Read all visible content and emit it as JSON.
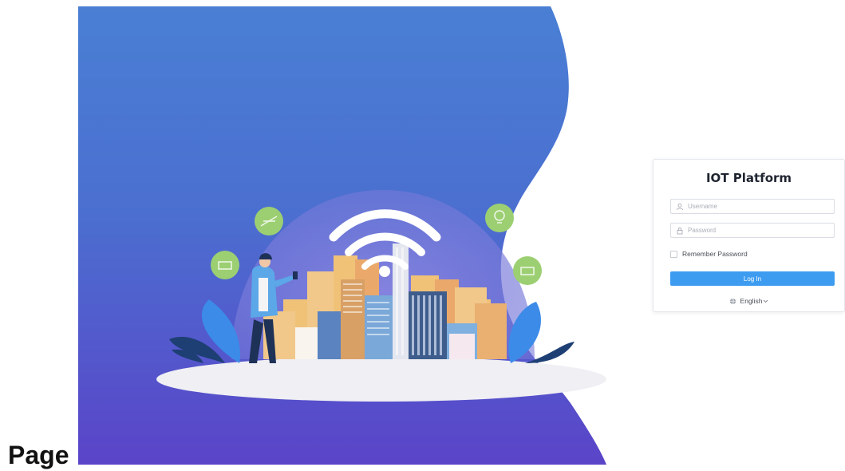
{
  "page_label": "Page",
  "login": {
    "title": "IOT Platform",
    "username_placeholder": "Username",
    "password_placeholder": "Password",
    "remember_label": "Remember Password",
    "login_button": "Log In",
    "language": "English"
  },
  "colors": {
    "hero_top": "#4a7fd4",
    "hero_bottom": "#5a44c8",
    "accent_button": "#3d9cf0"
  },
  "icons": [
    "user-icon",
    "lock-icon",
    "checkbox",
    "globe-icon",
    "chevron-down-icon",
    "wifi-icon"
  ]
}
